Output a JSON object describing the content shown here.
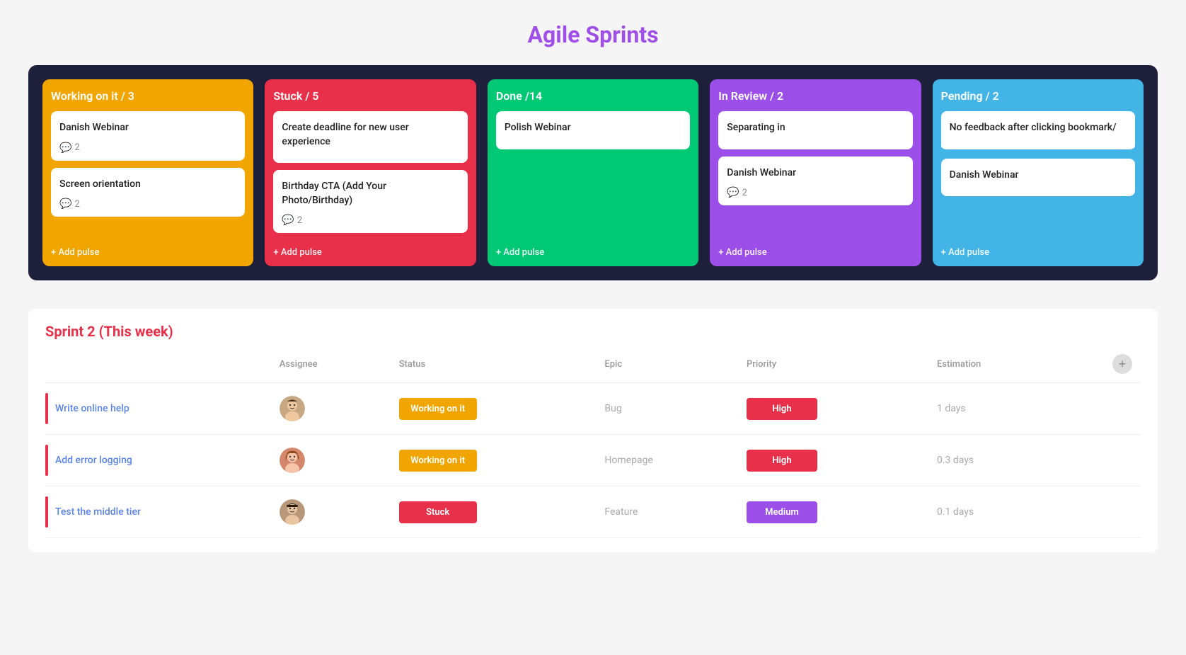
{
  "page": {
    "title": "Agile Sprints"
  },
  "board": {
    "columns": [
      {
        "id": "working",
        "label": "Working on it / 3",
        "colorClass": "col-working",
        "cards": [
          {
            "title": "Danish Webinar",
            "comments": 2
          },
          {
            "title": "Screen orientation",
            "comments": 2
          }
        ],
        "addLabel": "+ Add pulse"
      },
      {
        "id": "stuck",
        "label": "Stuck / 5",
        "colorClass": "col-stuck",
        "cards": [
          {
            "title": "Create deadline for new user experience",
            "comments": null
          },
          {
            "title": "Birthday CTA (Add Your Photo/Birthday)",
            "comments": 2
          }
        ],
        "addLabel": "+ Add pulse"
      },
      {
        "id": "done",
        "label": "Done /14",
        "colorClass": "col-done",
        "cards": [
          {
            "title": "Polish Webinar",
            "comments": null
          }
        ],
        "addLabel": "+ Add pulse"
      },
      {
        "id": "review",
        "label": "In Review / 2",
        "colorClass": "col-review",
        "cards": [
          {
            "title": "Separating in",
            "comments": null
          },
          {
            "title": "Danish Webinar",
            "comments": 2
          }
        ],
        "addLabel": "+ Add pulse"
      },
      {
        "id": "pending",
        "label": "Pending / 2",
        "colorClass": "col-pending",
        "cards": [
          {
            "title": "No feedback after clicking bookmark/",
            "comments": null,
            "border": true
          },
          {
            "title": "Danish Webinar",
            "comments": null
          }
        ],
        "addLabel": "+ Add pulse"
      }
    ]
  },
  "sprint": {
    "title": "Sprint 2 (This week)",
    "columns": {
      "assignee": "Assignee",
      "status": "Status",
      "epic": "Epic",
      "priority": "Priority",
      "estimation": "Estimation"
    },
    "rows": [
      {
        "task": "Write online help",
        "avatar": "male1",
        "status": "Working on it",
        "statusClass": "status-working",
        "epic": "Bug",
        "priority": "High",
        "priorityClass": "priority-high",
        "estimation": "1 days"
      },
      {
        "task": "Add error logging",
        "avatar": "female1",
        "status": "Working on it",
        "statusClass": "status-working",
        "epic": "Homepage",
        "priority": "High",
        "priorityClass": "priority-high",
        "estimation": "0.3 days"
      },
      {
        "task": "Test the middle tier",
        "avatar": "male2",
        "status": "Stuck",
        "statusClass": "status-stuck",
        "epic": "Feature",
        "priority": "Medium",
        "priorityClass": "priority-medium",
        "estimation": "0.1 days"
      }
    ]
  },
  "icons": {
    "comment": "💬",
    "add": "+"
  }
}
